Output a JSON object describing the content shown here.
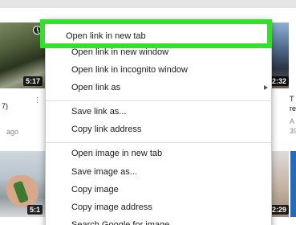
{
  "background": {
    "left_durations": [
      "5:17",
      "5:1"
    ],
    "right_durations": [
      "2:32",
      "2:29"
    ],
    "left_text": [
      "7)",
      "ago"
    ],
    "right_text": [
      "T",
      "re",
      "A",
      "39"
    ]
  },
  "context_menu": {
    "highlighted_item": "Open link in new tab",
    "items": [
      "Open link in new window",
      "Open link in incognito window",
      "Open link as",
      "Save link as...",
      "Copy link address",
      "Open image in new tab",
      "Save image as...",
      "Copy image",
      "Copy image address",
      "Search Google for image"
    ]
  },
  "colors": {
    "highlight": "#35e02b",
    "menu_bg": "#ffffff"
  },
  "icons": [
    "clock-icon",
    "submenu-arrow-icon",
    "kebab-menu-icon"
  ]
}
